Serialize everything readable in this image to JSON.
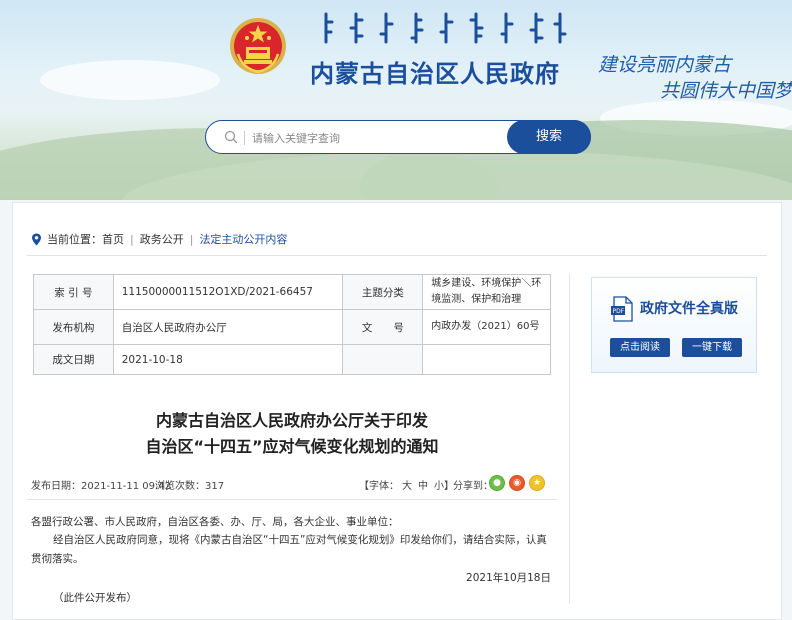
{
  "header": {
    "site_title": "内蒙古自治区人民政府",
    "slogan_line1": "建设亮丽内蒙古",
    "slogan_line2": "共圆伟大中国梦",
    "search": {
      "placeholder": "请输入关键字查询",
      "button": "搜索"
    }
  },
  "breadcrumb": {
    "label": "当前位置：",
    "items": [
      "首页",
      "政务公开",
      "法定主动公开内容"
    ]
  },
  "info_table": {
    "index_label": "索 引 号",
    "index_value": "11150000011512O1XD/2021-66457",
    "topic_label": "主题分类",
    "topic_value": "城乡建设、环境保护＼环境监测、保护和治理",
    "issuer_label": "发布机构",
    "issuer_value": "自治区人民政府办公厅",
    "docno_label": "文　　号",
    "docno_value": "内政办发（2021）60号",
    "date_label": "成文日期",
    "date_value": "2021-10-18"
  },
  "sidebar": {
    "title": "政府文件全真版",
    "read_button": "点击阅读",
    "download_button": "一键下载"
  },
  "article": {
    "title_line1": "内蒙古自治区人民政府办公厅关于印发",
    "title_line2": "自治区“十四五”应对气候变化规划的通知",
    "publish_date": "发布日期：2021-11-11 09:42",
    "views": "浏览次数：317",
    "font_label": "【字体：",
    "font_large": "大",
    "font_medium": "中",
    "font_small": "小】",
    "share_label": "分享到：",
    "para1": "各盟行政公署、市人民政府，自治区各委、办、厅、局，各大企业、事业单位：",
    "para2": "经自治区人民政府同意，现将《内蒙古自治区“十四五”应对气候变化规划》印发给你们，请结合实际，认真贯彻落实。",
    "sign_date": "2021年10月18日",
    "note": "（此件公开发布）"
  },
  "colors": {
    "brand_blue": "#1b4f9c",
    "wechat": "#6cc04a",
    "weibo": "#e95b2c",
    "favorite": "#f2c12e"
  }
}
